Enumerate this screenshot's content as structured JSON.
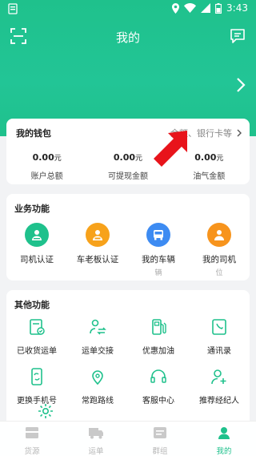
{
  "status_bar": {
    "time": "3:43"
  },
  "header": {
    "title": "我的"
  },
  "wallet": {
    "title": "我的钱包",
    "more_text": "余额、银行卡等",
    "items": [
      {
        "amount": "0.00",
        "unit": "元",
        "label": "账户总额"
      },
      {
        "amount": "0.00",
        "unit": "元",
        "label": "可提现金额"
      },
      {
        "amount": "0.00",
        "unit": "元",
        "label": "油气金额"
      }
    ]
  },
  "business": {
    "title": "业务功能",
    "items": [
      {
        "label": "司机认证",
        "sub": "",
        "icon": "driver-id-icon",
        "color": "#1fc18c"
      },
      {
        "label": "车老板认证",
        "sub": "",
        "icon": "owner-id-icon",
        "color": "#f7a21b"
      },
      {
        "label": "我的车辆",
        "sub": "辆",
        "icon": "bus-icon",
        "color": "#3d8bf2"
      },
      {
        "label": "我的司机",
        "sub": "位",
        "icon": "driver-icon",
        "color": "#f7941d"
      }
    ]
  },
  "other": {
    "title": "其他功能",
    "items": [
      {
        "label": "已收货运单",
        "icon": "received-orders-icon"
      },
      {
        "label": "运单交接",
        "icon": "handover-icon"
      },
      {
        "label": "优惠加油",
        "icon": "fuel-icon"
      },
      {
        "label": "通讯录",
        "icon": "contacts-icon"
      },
      {
        "label": "更换手机号",
        "icon": "change-phone-icon"
      },
      {
        "label": "常跑路线",
        "icon": "route-icon"
      },
      {
        "label": "客服中心",
        "icon": "headset-icon"
      },
      {
        "label": "推荐经纪人",
        "icon": "add-user-icon"
      }
    ]
  },
  "tabbar": {
    "items": [
      {
        "label": "货源",
        "active": false
      },
      {
        "label": "运单",
        "active": false
      },
      {
        "label": "群组",
        "active": false
      },
      {
        "label": "我的",
        "active": true
      }
    ]
  },
  "colors": {
    "brand": "#1fc18c",
    "arrow": "#e8141b"
  }
}
